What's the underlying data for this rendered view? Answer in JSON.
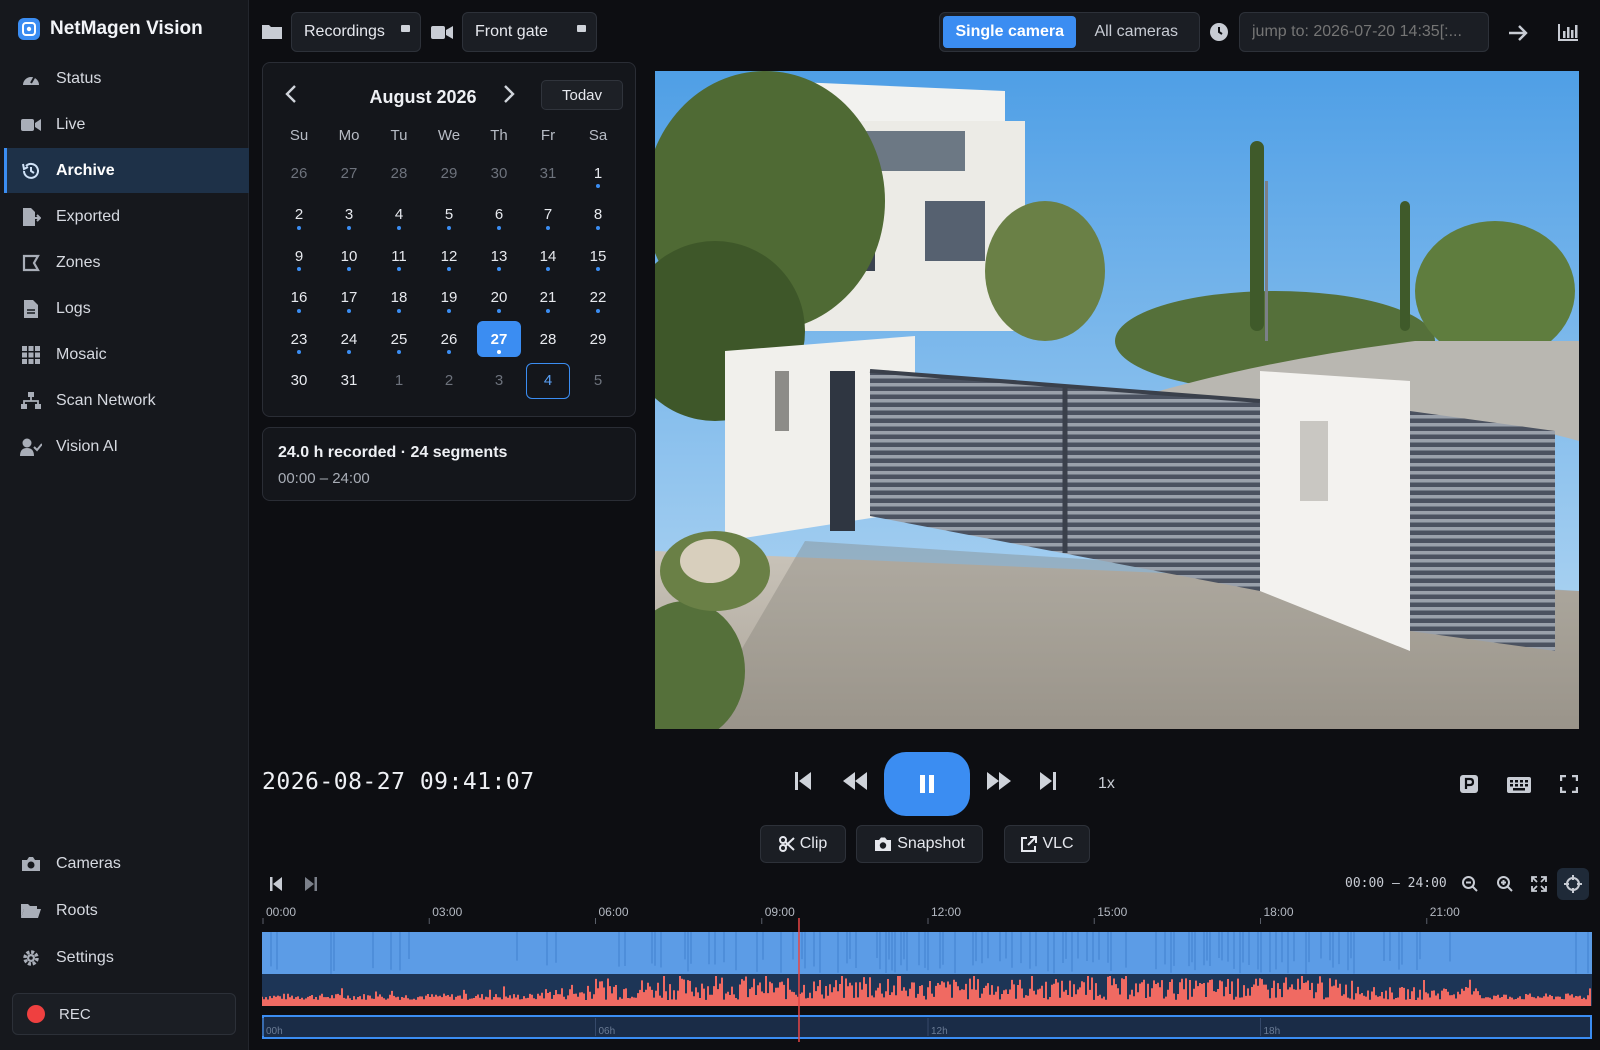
{
  "app": {
    "name": "NetMagen Vision"
  },
  "sidebar": {
    "items": [
      {
        "label": "Status",
        "icon": "gauge-icon"
      },
      {
        "label": "Live",
        "icon": "video-camera-icon"
      },
      {
        "label": "Archive",
        "icon": "history-icon",
        "active": true
      },
      {
        "label": "Exported",
        "icon": "file-export-icon"
      },
      {
        "label": "Zones",
        "icon": "zone-icon"
      },
      {
        "label": "Logs",
        "icon": "file-icon"
      },
      {
        "label": "Mosaic",
        "icon": "grid-icon"
      },
      {
        "label": "Scan Network",
        "icon": "network-icon"
      },
      {
        "label": "Vision AI",
        "icon": "user-check-icon"
      }
    ],
    "bottom_items": [
      {
        "label": "Cameras",
        "icon": "camera-icon"
      },
      {
        "label": "Roots",
        "icon": "folder-open-icon"
      },
      {
        "label": "Settings",
        "icon": "gear-icon"
      }
    ],
    "rec_label": "REC"
  },
  "topbar": {
    "source_label": "Recordings",
    "camera_label": "Front gate",
    "mode_single": "Single camera",
    "mode_all": "All cameras",
    "jump_placeholder": "jump to: 2026-07-20 14:35[:..."
  },
  "calendar": {
    "month_label": "August 2026",
    "today_label": "Todav",
    "weekdays": [
      "Su",
      "Mo",
      "Tu",
      "We",
      "Th",
      "Fr",
      "Sa"
    ],
    "weeks": [
      [
        {
          "d": "26",
          "m": true
        },
        {
          "d": "27",
          "m": true
        },
        {
          "d": "28",
          "m": true
        },
        {
          "d": "29",
          "m": true
        },
        {
          "d": "30",
          "m": true
        },
        {
          "d": "31",
          "m": true
        },
        {
          "d": "1",
          "dot": true
        }
      ],
      [
        {
          "d": "2",
          "dot": true
        },
        {
          "d": "3",
          "dot": true
        },
        {
          "d": "4",
          "dot": true
        },
        {
          "d": "5",
          "dot": true
        },
        {
          "d": "6",
          "dot": true
        },
        {
          "d": "7",
          "dot": true
        },
        {
          "d": "8",
          "dot": true
        }
      ],
      [
        {
          "d": "9",
          "dot": true
        },
        {
          "d": "10",
          "dot": true
        },
        {
          "d": "11",
          "dot": true
        },
        {
          "d": "12",
          "dot": true
        },
        {
          "d": "13",
          "dot": true
        },
        {
          "d": "14",
          "dot": true
        },
        {
          "d": "15",
          "dot": true
        }
      ],
      [
        {
          "d": "16",
          "dot": true
        },
        {
          "d": "17",
          "dot": true
        },
        {
          "d": "18",
          "dot": true
        },
        {
          "d": "19",
          "dot": true
        },
        {
          "d": "20",
          "dot": true
        },
        {
          "d": "21",
          "dot": true
        },
        {
          "d": "22",
          "dot": true
        }
      ],
      [
        {
          "d": "23",
          "dot": true
        },
        {
          "d": "24",
          "dot": true
        },
        {
          "d": "25",
          "dot": true
        },
        {
          "d": "26",
          "dot": true
        },
        {
          "d": "27",
          "dot": true,
          "selected": true
        },
        {
          "d": "28"
        },
        {
          "d": "29"
        }
      ],
      [
        {
          "d": "30"
        },
        {
          "d": "31"
        },
        {
          "d": "1",
          "m": true
        },
        {
          "d": "2",
          "m": true
        },
        {
          "d": "3",
          "m": true
        },
        {
          "d": "4",
          "m": true,
          "today": true
        },
        {
          "d": "5",
          "m": true
        }
      ]
    ]
  },
  "summary": {
    "title": "24.0 h recorded · 24 segments",
    "range": "00:00 – 24:00"
  },
  "playback": {
    "timestamp": "2026-08-27 09:41:07",
    "speed": "1x",
    "clip_label": "Clip",
    "snapshot_label": "Snapshot",
    "vlc_label": "VLC"
  },
  "timeline": {
    "range_label": "00:00 – 24:00",
    "hour_labels": [
      "00:00",
      "03:00",
      "06:00",
      "09:00",
      "12:00",
      "15:00",
      "18:00",
      "21:00"
    ],
    "overview_labels": [
      "00h",
      "06h",
      "12h",
      "18h"
    ],
    "playhead_hour": 9.69,
    "colors": {
      "recording": "#5c9ce6",
      "motion": "#f06a62",
      "playhead": "#e84545",
      "accent": "#3b8df2"
    }
  }
}
